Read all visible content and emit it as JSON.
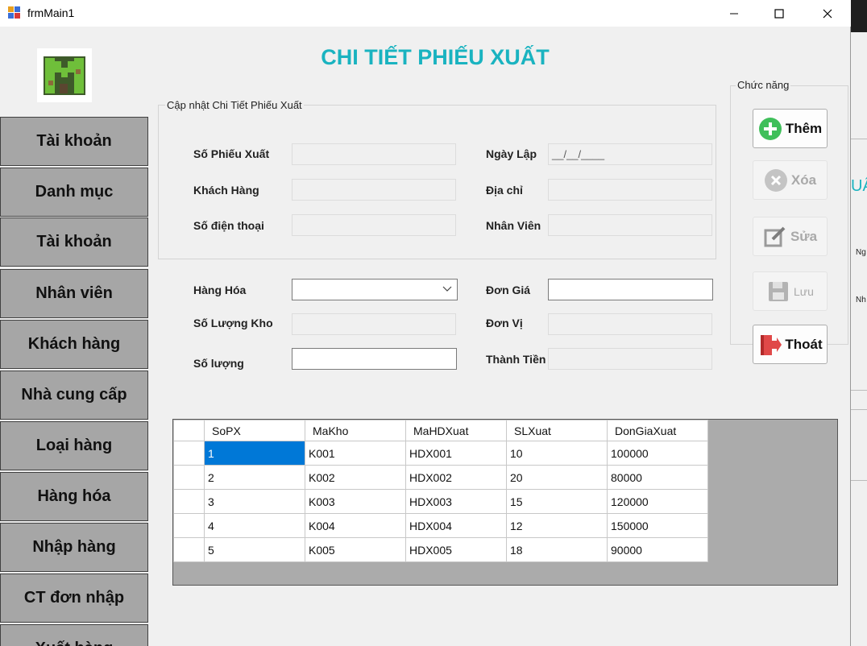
{
  "window": {
    "title": "frmMain1"
  },
  "page_title": "CHI TIẾT PHIẾU XUẤT",
  "nav": {
    "items": [
      {
        "label": "Tài khoản"
      },
      {
        "label": "Danh mục"
      },
      {
        "label": "Tài khoản"
      },
      {
        "label": "Nhân viên"
      },
      {
        "label": "Khách hàng"
      },
      {
        "label": "Nhà cung cấp"
      },
      {
        "label": "Loại hàng"
      },
      {
        "label": "Hàng hóa"
      },
      {
        "label": "Nhập hàng"
      },
      {
        "label": "CT đơn nhập"
      },
      {
        "label": "Xuất hàng"
      }
    ]
  },
  "update_group": {
    "legend": "Cập nhật Chi Tiết Phiếu Xuất",
    "so_phieu_xuat_label": "Số Phiếu Xuất",
    "ngay_lap_label": "Ngày Lập",
    "ngay_lap_mask": "__/__/____",
    "khach_hang_label": "Khách Hàng",
    "dia_chi_label": "Địa chỉ",
    "so_dien_thoai_label": "Số điện thoại",
    "nhan_vien_label": "Nhân Viên"
  },
  "detail": {
    "hang_hoa_label": "Hàng Hóa",
    "don_gia_label": "Đơn Giá",
    "so_luong_kho_label": "Số Lượng Kho",
    "don_vi_label": "Đơn Vị",
    "so_luong_label": "Số lượng",
    "thanh_tien_label": "Thành Tiền"
  },
  "functions": {
    "legend": "Chức năng",
    "them": "Thêm",
    "xoa": "Xóa",
    "sua": "Sửa",
    "luu": "Lưu",
    "thoat": "Thoát"
  },
  "grid": {
    "columns": [
      "SoPX",
      "MaKho",
      "MaHDXuat",
      "SLXuat",
      "DonGiaXuat"
    ],
    "rows": [
      [
        "1",
        "K001",
        "HDX001",
        "10",
        "100000"
      ],
      [
        "2",
        "K002",
        "HDX002",
        "20",
        "80000"
      ],
      [
        "3",
        "K003",
        "HDX003",
        "15",
        "120000"
      ],
      [
        "4",
        "K004",
        "HDX004",
        "12",
        "150000"
      ],
      [
        "5",
        "K005",
        "HDX005",
        "18",
        "90000"
      ]
    ]
  },
  "background_window": {
    "text_fragments": [
      "UẤ",
      "Ng",
      "Nh"
    ]
  },
  "colors": {
    "title_teal": "#1ab3c0",
    "nav_bg": "#a6a6a6",
    "selected_cell": "#0078d7",
    "grid_bg": "#ababab"
  }
}
